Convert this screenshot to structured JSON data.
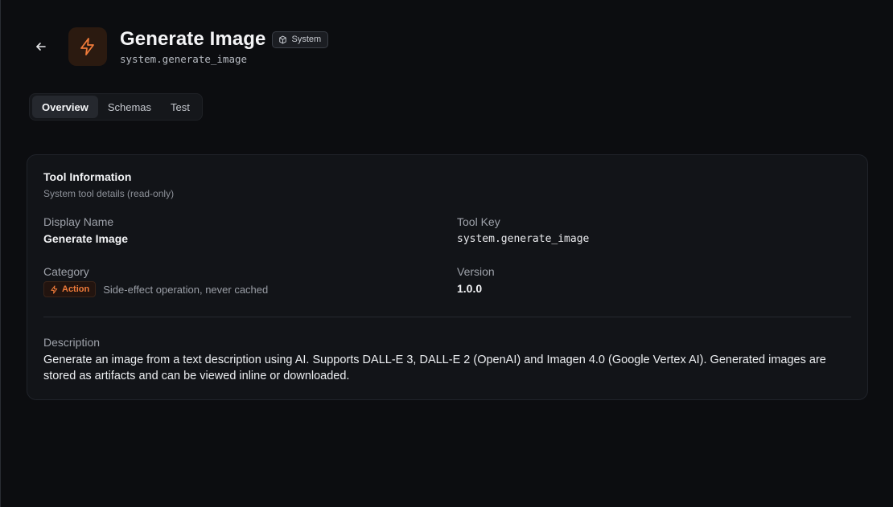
{
  "header": {
    "title": "Generate Image",
    "badge": "System",
    "tool_key": "system.generate_image",
    "back_icon": "arrow-left-icon",
    "tool_icon": "lightning-bolt-icon",
    "badge_icon": "cube-icon"
  },
  "tabs": [
    {
      "label": "Overview",
      "active": true
    },
    {
      "label": "Schemas",
      "active": false
    },
    {
      "label": "Test",
      "active": false
    }
  ],
  "card": {
    "title": "Tool Information",
    "subtitle": "System tool details (read-only)",
    "display_name_label": "Display Name",
    "display_name_value": "Generate Image",
    "tool_key_label": "Tool Key",
    "tool_key_value": "system.generate_image",
    "category_label": "Category",
    "category_badge": "Action",
    "category_desc": "Side-effect operation, never cached",
    "version_label": "Version",
    "version_value": "1.0.0",
    "description_label": "Description",
    "description_value": "Generate an image from a text description using AI. Supports DALL-E 3, DALL-E 2 (OpenAI) and Imagen 4.0 (Google Vertex AI). Generated images are stored as artifacts and can be viewed inline or downloaded."
  },
  "colors": {
    "accent": "#f07b3a",
    "background": "#0c0d10",
    "card": "#121418"
  }
}
